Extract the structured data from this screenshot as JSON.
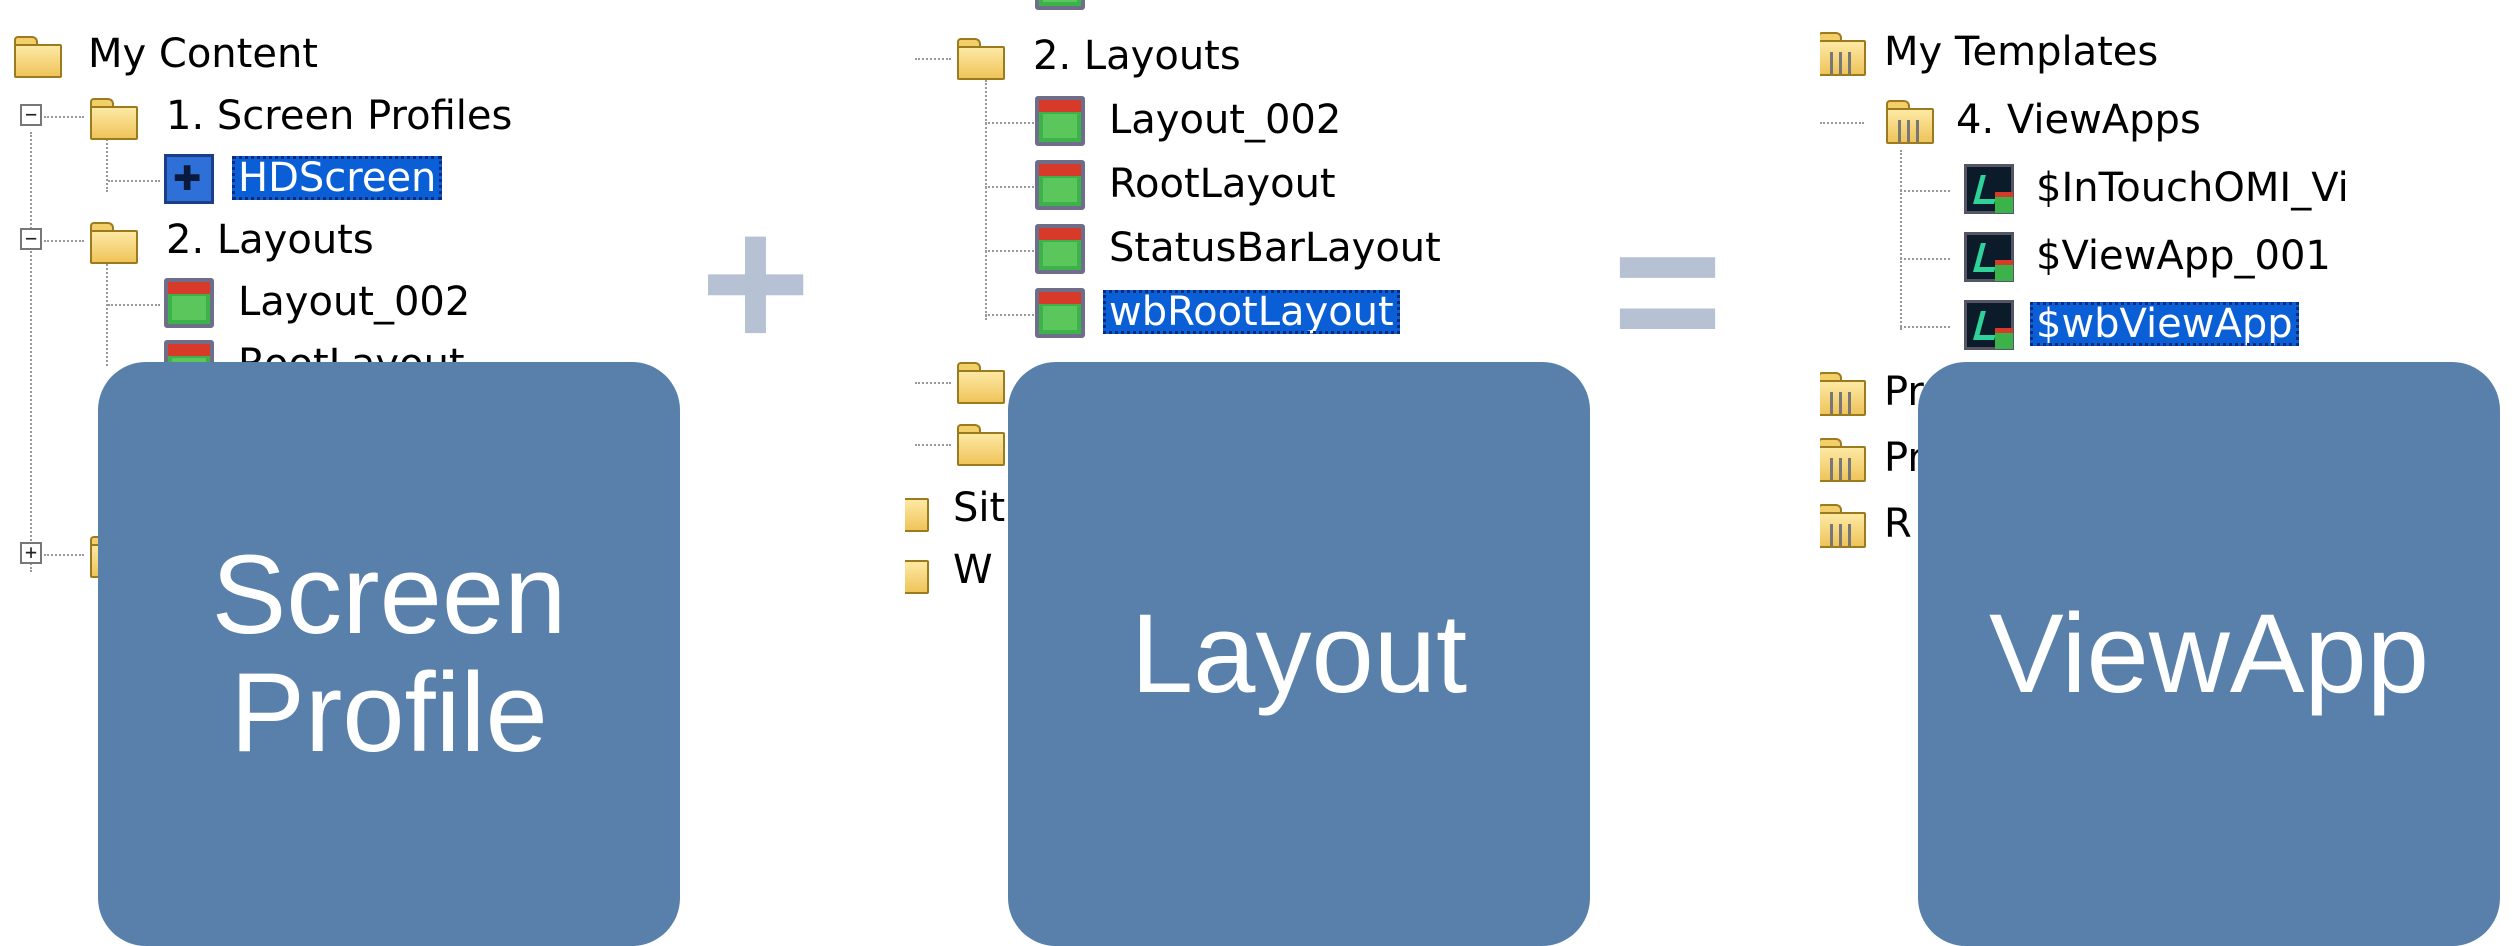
{
  "panel1": {
    "root": "My Content",
    "screen_profiles_folder": "1. Screen Profiles",
    "hdscreen": "HDScreen",
    "layouts_folder": "2. Layouts",
    "layout_002": "Layout_002",
    "partial_item": "RootLayout"
  },
  "panel2": {
    "layouts_folder": "2. Layouts",
    "items": [
      "Layout_002",
      "RootLayout",
      "StatusBarLayout",
      "wbRootLayout"
    ],
    "partial_site": "Sit",
    "partial_w": "W"
  },
  "panel3": {
    "root": "My Templates",
    "viewapps_folder": "4. ViewApps",
    "items": [
      "$InTouchOMI_Vi",
      "$ViewApp_001",
      "$wbViewApp"
    ],
    "partial_pr1": "Pr",
    "partial_pr2": "Pr",
    "partial_r": "R"
  },
  "operators": {
    "plus": "+",
    "equals": "="
  },
  "cards": {
    "screen_profile": [
      "Screen",
      "Profile"
    ],
    "layout": "Layout",
    "viewapp": "ViewApp"
  },
  "colors": {
    "card": "#5880aa",
    "selection": "#0a5fd6",
    "operator": "#b6c1d3"
  }
}
